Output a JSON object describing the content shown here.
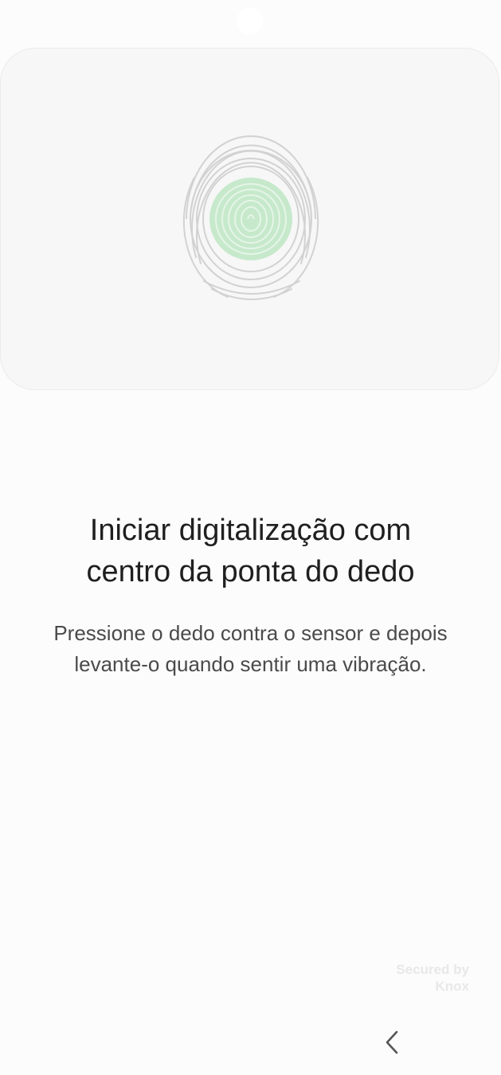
{
  "enrollment": {
    "title_line1": "Iniciar digitalização com",
    "title_line2": "centro da ponta do dedo",
    "description_line1": "Pressione o dedo contra o sensor e depois",
    "description_line2": "levante-o quando sentir uma vibração."
  },
  "fingerprint": {
    "icon": "fingerprint-icon",
    "ridge_color": "#d2d2d2",
    "highlight_color": "#c6e9cb"
  },
  "footer": {
    "knox_line1": "Secured by",
    "knox_line2": "Knox"
  },
  "navigation": {
    "back_icon": "chevron-left-icon"
  }
}
